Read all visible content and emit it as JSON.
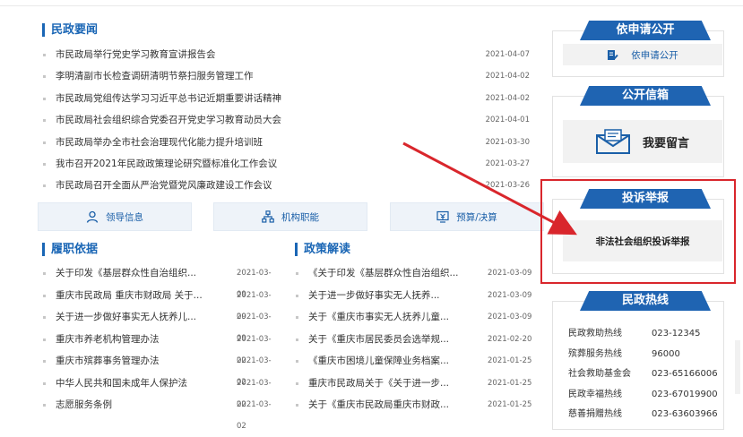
{
  "news": {
    "title": "民政要闻",
    "items": [
      {
        "text": "市民政局举行党史学习教育宣讲报告会",
        "date": "2021-04-07"
      },
      {
        "text": "李明清副市长检查调研清明节祭扫服务管理工作",
        "date": "2021-04-02"
      },
      {
        "text": "市民政局党组传达学习习近平总书记近期重要讲话精神",
        "date": "2021-04-02"
      },
      {
        "text": "市民政局社会组织综合党委召开党史学习教育动员大会",
        "date": "2021-04-01"
      },
      {
        "text": "市民政局举办全市社会治理现代化能力提升培训班",
        "date": "2021-03-30"
      },
      {
        "text": "我市召开2021年民政政策理论研究暨标准化工作会议",
        "date": "2021-03-27"
      },
      {
        "text": "市民政局召开全面从严治党暨党风廉政建设工作会议",
        "date": "2021-03-26"
      }
    ]
  },
  "quick_links": [
    {
      "label": "领导信息",
      "icon": "person-icon"
    },
    {
      "label": "机构职能",
      "icon": "org-chart-icon"
    },
    {
      "label": "预算/决算",
      "icon": "budget-icon"
    }
  ],
  "duties": {
    "title": "履职依据",
    "items": [
      {
        "text": "关于印发《基层群众性自治组织...",
        "date": "2021-03-09"
      },
      {
        "text": "重庆市民政局 重庆市财政局 关于...",
        "date": "2021-03-09"
      },
      {
        "text": "关于进一步做好事实无人抚养儿...",
        "date": "2021-03-09"
      },
      {
        "text": "重庆市养老机构管理办法",
        "date": "2021-03-02"
      },
      {
        "text": "重庆市殡葬事务管理办法",
        "date": "2021-03-02"
      },
      {
        "text": "中华人民共和国未成年人保护法",
        "date": "2021-03-02"
      },
      {
        "text": "志愿服务条例",
        "date": "2021-03-02"
      }
    ]
  },
  "policy": {
    "title": "政策解读",
    "items": [
      {
        "text": "《关于印发《基层群众性自治组织...",
        "date": "2021-03-09"
      },
      {
        "text": "关于进一步做好事实无人抚养...",
        "date": "2021-03-09"
      },
      {
        "text": "关于《重庆市事实无人抚养儿童...",
        "date": "2021-03-09"
      },
      {
        "text": "关于《重庆市居民委员会选举规...",
        "date": "2021-02-20"
      },
      {
        "text": "《重庆市困境儿童保障业务档案...",
        "date": "2021-01-25"
      },
      {
        "text": "重庆市民政局关于《关于进一步...",
        "date": "2021-01-25"
      },
      {
        "text": "关于《重庆市民政局重庆市财政...",
        "date": "2021-01-25"
      }
    ]
  },
  "apply": {
    "title": "依申请公开",
    "button": "依申请公开"
  },
  "mailbox": {
    "title": "公开信箱",
    "button": "我要留言"
  },
  "complaint": {
    "title": "投诉举报",
    "button": "非法社会组织投诉举报"
  },
  "hotline": {
    "title": "民政热线",
    "items": [
      {
        "name": "民政救助热线",
        "phone": "023-12345"
      },
      {
        "name": "殡葬服务热线",
        "phone": "96000"
      },
      {
        "name": "社会救助基金会",
        "phone": "023-65166006"
      },
      {
        "name": "民政幸福热线",
        "phone": "023-67019900"
      },
      {
        "name": "慈善捐赠热线",
        "phone": "023-63603966"
      }
    ]
  },
  "colors": {
    "primary": "#1f64b2",
    "annotation": "#d9262c"
  }
}
